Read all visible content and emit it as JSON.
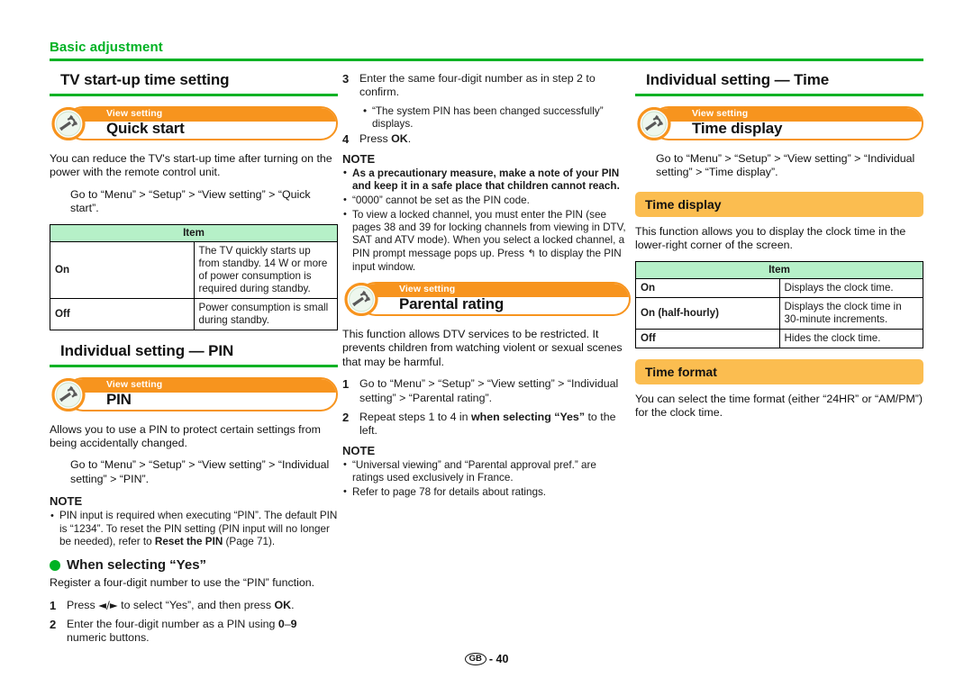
{
  "running_head": {
    "text": "Basic adjustment",
    "rule_color": "#00b224"
  },
  "footer": {
    "region_mark": "GB",
    "separator": "-",
    "page_number": "40"
  },
  "icons": {
    "wrench": "wrench-icon",
    "return_arrow": "return-arrow-icon",
    "left_right_arrows": "left-right-arrow-icon"
  },
  "columns": {
    "left": {
      "section1": {
        "heading": "TV start-up time setting",
        "banner": {
          "label": "View setting",
          "title": "Quick start"
        },
        "intro": "You can reduce the TV's start-up time after turning on the power with the remote control unit.",
        "path": "Go to “Menu” > “Setup” > “View setting” > “Quick start”.",
        "table": {
          "header": "Item",
          "rows": [
            {
              "key": "On",
              "value": "The TV quickly starts up from standby. 14 W or more of power consumption is required during standby."
            },
            {
              "key": "Off",
              "value": "Power consumption is small during standby."
            }
          ]
        }
      },
      "section2": {
        "heading": "Individual setting — PIN",
        "banner": {
          "label": "View setting",
          "title": "PIN"
        },
        "intro": "Allows you to use a PIN to protect certain settings from being accidentally changed.",
        "path": "Go to “Menu” > “Setup” > “View setting” > “Individual setting” > “PIN”.",
        "note_heading": "NOTE",
        "notes": [
          "PIN input is required when executing “PIN”. The default PIN is “1234”. To reset the PIN setting (PIN input will no longer be needed), refer to Reset the PIN (Page 71)."
        ],
        "subheading": "When selecting “Yes”",
        "sub_intro": "Register a four-digit number to use the “PIN” function.",
        "steps": [
          {
            "n": "1",
            "text": "Press ◄/► to select “Yes”, and then press OK."
          },
          {
            "n": "2",
            "text": "Enter the four-digit number as a PIN using 0–9 numeric buttons."
          }
        ]
      }
    },
    "middle": {
      "steps_continued": [
        {
          "n": "3",
          "text": "Enter the same four-digit number as in step 2 to confirm."
        },
        {
          "n": "4",
          "text": "Press OK."
        }
      ],
      "substep": "“The system PIN has been changed successfully” displays.",
      "note_heading": "NOTE",
      "notes": [
        "As a precautionary measure, make a note of your PIN and keep it in a safe place that children cannot reach.",
        "“0000” cannot be set as the PIN code.",
        "To view a locked channel, you must enter the PIN (see pages 38 and 39 for locking channels from viewing in DTV, SAT and ATV mode). When you select a locked channel, a PIN prompt message pops up. Press ↰ to display the PIN input window."
      ],
      "section": {
        "banner": {
          "label": "View setting",
          "title": "Parental rating"
        },
        "intro": "This function allows DTV services to be restricted. It prevents children from watching violent or sexual scenes that may be harmful.",
        "steps": [
          {
            "n": "1",
            "text": "Go to “Menu” > “Setup” > “View setting” > “Individual setting” > “Parental rating”."
          },
          {
            "n": "2",
            "text": "Repeat steps 1 to 4 in when selecting “Yes” to the left."
          }
        ],
        "note_heading": "NOTE",
        "notes": [
          "“Universal viewing” and “Parental approval pref.” are ratings used exclusively in France.",
          "Refer to page 78 for details about ratings."
        ]
      }
    },
    "right": {
      "heading": "Individual setting — Time",
      "banner": {
        "label": "View setting",
        "title": "Time display"
      },
      "path": "Go to “Menu” > “Setup” > “View setting” > “Individual setting” > “Time display”.",
      "subheading1": "Time display",
      "intro1": "This function allows you to display the clock time in the lower-right corner of the screen.",
      "table": {
        "header": "Item",
        "rows": [
          {
            "key": "On",
            "value": "Displays the clock time."
          },
          {
            "key": "On (half-hourly)",
            "value": "Displays the clock time in 30-minute increments."
          },
          {
            "key": "Off",
            "value": "Hides the clock time."
          }
        ]
      },
      "subheading2": "Time format",
      "intro2": "You can select the time format (either “24HR” or “AM/PM”) for the clock time."
    }
  }
}
